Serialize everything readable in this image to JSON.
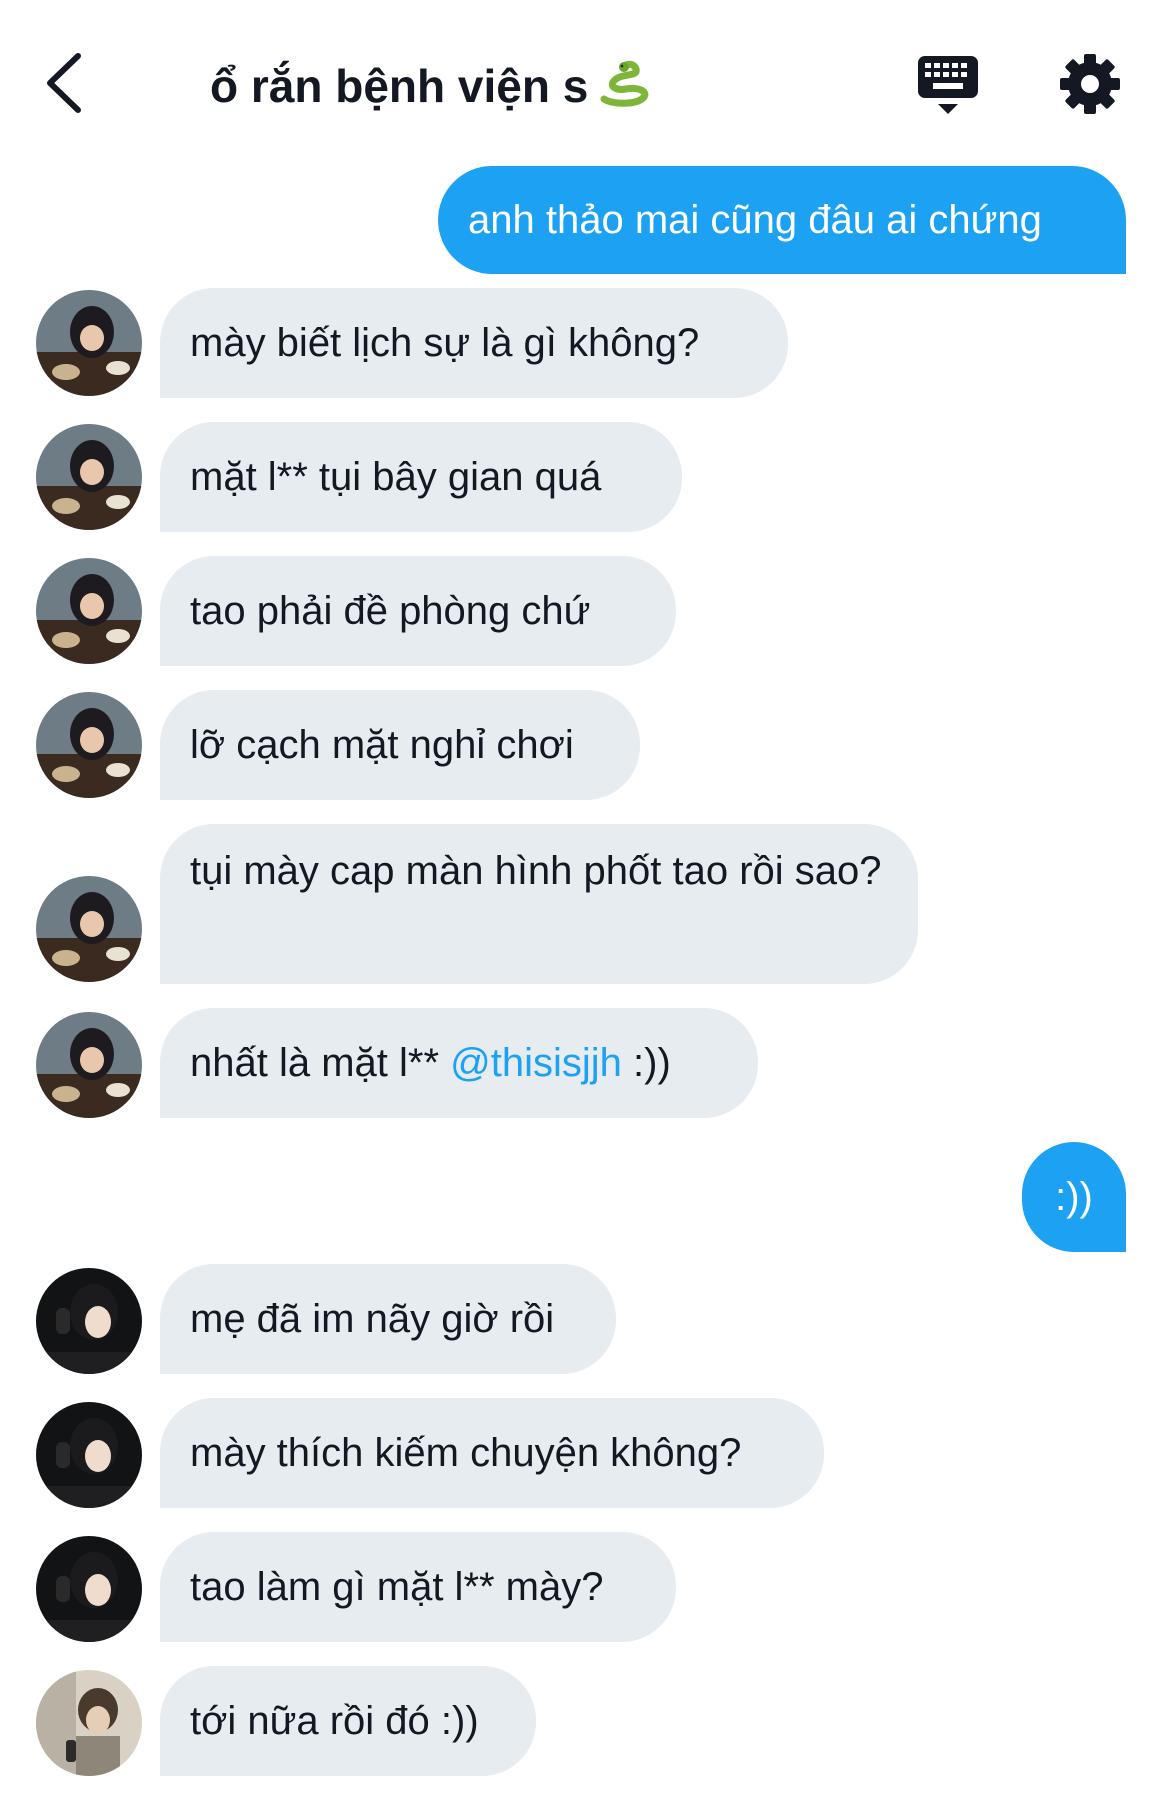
{
  "header": {
    "title": "ổ rắn bệnh viện s",
    "title_emoji_icon": "snake-icon",
    "back_icon": "chevron-left-icon",
    "keyboard_icon": "keyboard-icon",
    "settings_icon": "gear-icon"
  },
  "colors": {
    "outgoing_bubble": "#1da1f2",
    "incoming_bubble": "#e6ecf0",
    "mention": "#1da1f2"
  },
  "messages": [
    {
      "direction": "outgoing",
      "text": "anh thảo mai cũng đâu ai chứng"
    },
    {
      "direction": "incoming",
      "sender_avatar": "avatar-a",
      "text": "mày biết lịch sự là gì không?"
    },
    {
      "direction": "incoming",
      "sender_avatar": "avatar-a",
      "text": "mặt l** tụi bây gian quá"
    },
    {
      "direction": "incoming",
      "sender_avatar": "avatar-a",
      "text": "tao phải đề phòng chứ"
    },
    {
      "direction": "incoming",
      "sender_avatar": "avatar-a",
      "text": "lỡ cạch mặt nghỉ chơi"
    },
    {
      "direction": "incoming",
      "sender_avatar": "avatar-a",
      "text": "tụi mày cap màn hình phốt tao rồi sao?"
    },
    {
      "direction": "incoming",
      "sender_avatar": "avatar-a",
      "text_before": "nhất là mặt l** ",
      "mention": "@thisisjjh",
      "text_after": " :))"
    },
    {
      "direction": "outgoing",
      "text": ":))"
    },
    {
      "direction": "incoming",
      "sender_avatar": "avatar-b",
      "text": "mẹ đã im nãy giờ rồi"
    },
    {
      "direction": "incoming",
      "sender_avatar": "avatar-b",
      "text": "mày thích kiếm chuyện không?"
    },
    {
      "direction": "incoming",
      "sender_avatar": "avatar-b",
      "text": "tao làm gì mặt l** mày?"
    },
    {
      "direction": "incoming",
      "sender_avatar": "avatar-c",
      "text": "tới nữa rồi đó :))"
    }
  ]
}
